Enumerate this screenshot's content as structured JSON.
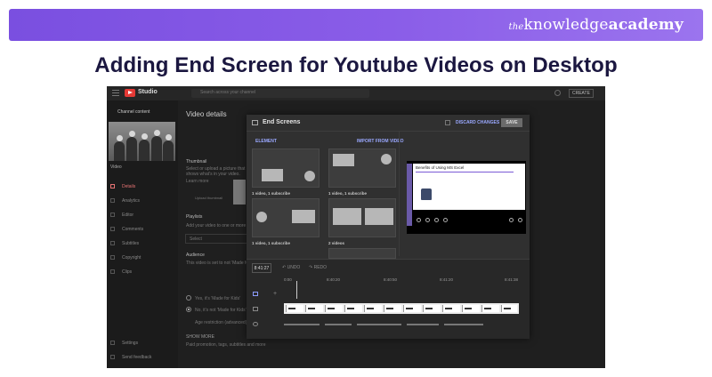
{
  "banner": {
    "brand_the": "the",
    "brand_knowledge": "knowledge",
    "brand_academy": "academy",
    "bg": "#8659e8"
  },
  "headline": "Adding End Screen for Youtube Videos on Desktop",
  "studio": {
    "logo_text": "Studio",
    "search_placeholder": "Search across your channel",
    "create_label": "CREATE"
  },
  "sidebar": {
    "channel_content": "Channel content",
    "video_label": "Video",
    "items": [
      {
        "label": "Details",
        "active": true
      },
      {
        "label": "Analytics"
      },
      {
        "label": "Editor"
      },
      {
        "label": "Comments"
      },
      {
        "label": "Subtitles"
      },
      {
        "label": "Copyright"
      },
      {
        "label": "Clips"
      }
    ],
    "bottom_items": [
      "Settings",
      "Send feedback"
    ]
  },
  "details": {
    "title": "Video details",
    "thumbnail_head": "Thumbnail",
    "thumbnail_text": "Select or upload a picture that shows what's in your video.",
    "learn_more": "Learn more",
    "upload_thumb": "Upload thumbnail",
    "playlists_head": "Playlists",
    "playlists_text": "Add your video to one or more playlists.",
    "playlist_select": "Select",
    "audience_head": "Audience",
    "audience_text": "This video is set to not 'Made for Kids'",
    "radio_yes": "Yes, it's 'Made for Kids'",
    "radio_no": "No, it's not 'Made for Kids'",
    "age_restriction": "Age restriction (advanced)",
    "show_more": "SHOW MORE",
    "show_more_text": "Paid promotion, tags, subtitles and more"
  },
  "end_screens": {
    "title": "End Screens",
    "discard": "DISCARD CHANGES",
    "save": "SAVE",
    "add_element": "ELEMENT",
    "import": "IMPORT FROM VIDEO",
    "templates": [
      "1 video, 1 subscribe",
      "1 video, 1 subscribe",
      "1 video, 1 subscribe",
      "2 videos"
    ],
    "preview_title": "Benefits of Using MS Excel",
    "timecode": "8:41:27",
    "undo": "UNDO",
    "redo": "REDO",
    "ticks": [
      "0:00",
      "8:40:20",
      "8:40:50",
      "8:41:20",
      "8:41:38"
    ]
  }
}
